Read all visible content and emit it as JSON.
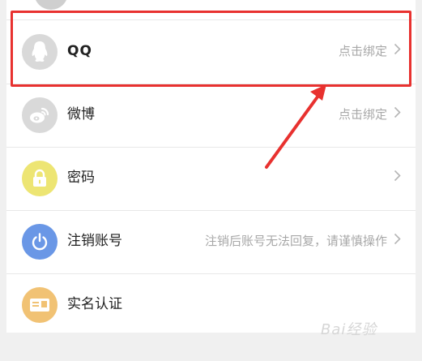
{
  "colors": {
    "qq_icon_bg": "#d9d9d9",
    "weibo_icon_bg": "#d9d9d9",
    "password_icon_bg": "#ede573",
    "cancel_icon_bg": "#6a97e6",
    "realname_icon_bg": "#f1c274",
    "highlight": "#e8312f"
  },
  "rows": [
    {
      "label": "QQ",
      "right": "点击绑定",
      "icon": "qq-penguin-icon"
    },
    {
      "label": "微博",
      "right": "点击绑定",
      "icon": "weibo-icon"
    },
    {
      "label": "密码",
      "right": "",
      "icon": "lock-icon"
    },
    {
      "label": "注销账号",
      "right": "注销后账号无法回复，请谨慎操作",
      "icon": "power-icon"
    },
    {
      "label": "实名认证",
      "right": "",
      "icon": "id-card-icon"
    }
  ],
  "watermark": "Bai经验"
}
